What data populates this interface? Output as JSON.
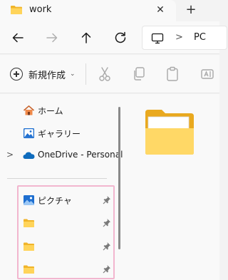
{
  "tab": {
    "title": "work",
    "close_glyph": "✕",
    "new_tab_glyph": "+"
  },
  "address": {
    "location": "PC",
    "separator": ">"
  },
  "command_bar": {
    "new_label": "新規作成",
    "new_caret": "⌄"
  },
  "sidebar": {
    "items": [
      {
        "label": "ホーム",
        "icon": "home-icon"
      },
      {
        "label": "ギャラリー",
        "icon": "gallery-icon"
      },
      {
        "label": "OneDrive - Personal",
        "icon": "onedrive-icon",
        "expand": ">"
      }
    ],
    "pinned": [
      {
        "label": "ピクチャ",
        "icon": "pictures-icon"
      },
      {
        "label": "",
        "icon": "folder-icon"
      },
      {
        "label": "",
        "icon": "folder-icon"
      },
      {
        "label": "",
        "icon": "folder-icon"
      }
    ]
  },
  "colors": {
    "folder": "#f7c948",
    "highlight": "#f2b6cf",
    "onedrive": "#0f6cbd"
  }
}
